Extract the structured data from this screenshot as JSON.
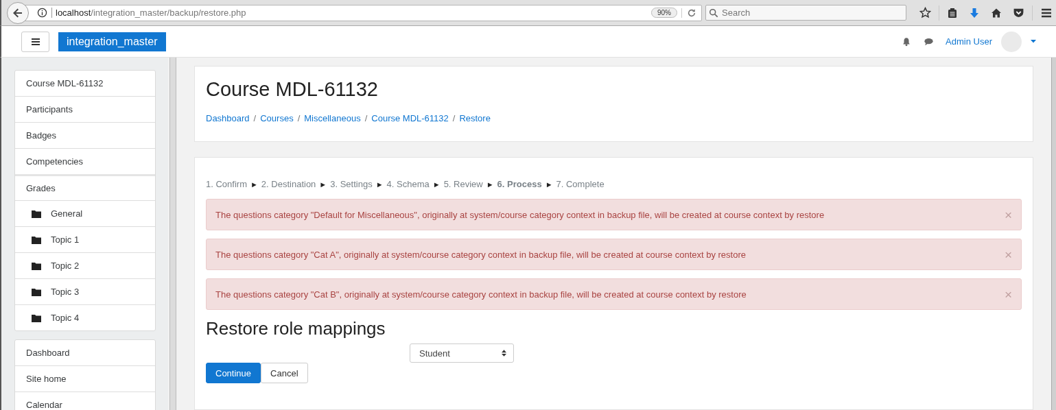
{
  "browser": {
    "url_host": "localhost",
    "url_path": "/integration_master/backup/restore.php",
    "zoom": "90%",
    "search_placeholder": "Search"
  },
  "navbar": {
    "brand": "integration_master",
    "user": "Admin User"
  },
  "sidebar": {
    "groups": [
      {
        "items": [
          {
            "label": "Course MDL-61132",
            "kind": "link"
          },
          {
            "label": "Participants",
            "kind": "link"
          },
          {
            "label": "Badges",
            "kind": "link"
          },
          {
            "label": "Competencies",
            "kind": "link"
          },
          {
            "label": "Grades",
            "kind": "link"
          },
          {
            "label": "General",
            "kind": "folder"
          },
          {
            "label": "Topic 1",
            "kind": "folder"
          },
          {
            "label": "Topic 2",
            "kind": "folder"
          },
          {
            "label": "Topic 3",
            "kind": "folder"
          },
          {
            "label": "Topic 4",
            "kind": "folder"
          }
        ]
      },
      {
        "items": [
          {
            "label": "Dashboard",
            "kind": "link"
          },
          {
            "label": "Site home",
            "kind": "link"
          },
          {
            "label": "Calendar",
            "kind": "link"
          }
        ]
      }
    ]
  },
  "page": {
    "title": "Course MDL-61132",
    "breadcrumbs": [
      {
        "label": "Dashboard",
        "separator": "/"
      },
      {
        "label": "Courses",
        "separator": "/"
      },
      {
        "label": "Miscellaneous",
        "separator": "/"
      },
      {
        "label": "Course MDL-61132",
        "separator": "/"
      },
      {
        "label": "Restore"
      }
    ]
  },
  "steps": [
    {
      "label": "1. Confirm",
      "selected": false,
      "separator": "►"
    },
    {
      "label": "2. Destination",
      "selected": false,
      "separator": "►"
    },
    {
      "label": "3. Settings",
      "selected": false,
      "separator": "►"
    },
    {
      "label": "4. Schema",
      "selected": false,
      "separator": "►"
    },
    {
      "label": "5. Review",
      "selected": false,
      "separator": "►"
    },
    {
      "label": "6. Process",
      "selected": true,
      "separator": "►"
    },
    {
      "label": "7. Complete",
      "selected": false
    }
  ],
  "alerts": [
    {
      "text": "The questions category \"Default for Miscellaneous\", originally at system/course category context in backup file, will be created at course context by restore",
      "close": "×"
    },
    {
      "text": "The questions category \"Cat A\", originally at system/course category context in backup file, will be created at course context by restore",
      "close": "×"
    },
    {
      "text": "The questions category \"Cat B\", originally at system/course category context in backup file, will be created at course context by restore",
      "close": "×"
    }
  ],
  "role_mappings": {
    "heading": "Restore role mappings",
    "select_value": "Student"
  },
  "buttons": [
    {
      "label": "Continue",
      "kind": "primary"
    },
    {
      "label": "Cancel",
      "kind": "secondary"
    }
  ]
}
